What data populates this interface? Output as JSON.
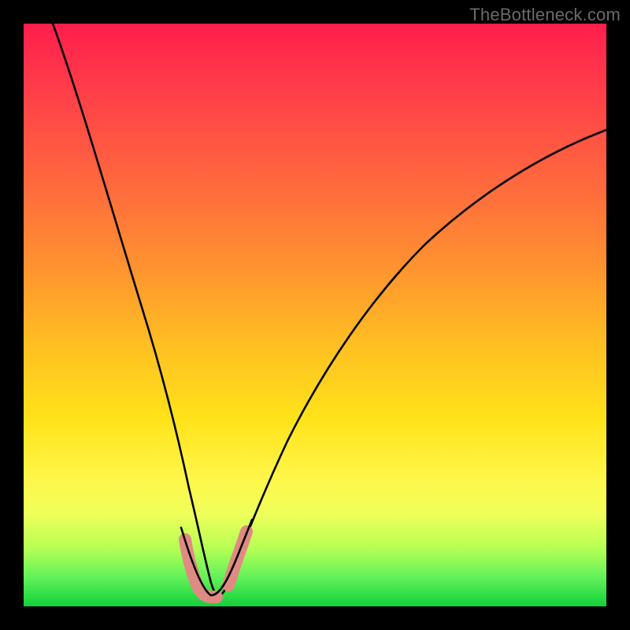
{
  "watermark": "TheBottleneck.com",
  "chart_data": {
    "type": "line",
    "title": "",
    "xlabel": "",
    "ylabel": "",
    "xlim": [
      0,
      100
    ],
    "ylim": [
      0,
      100
    ],
    "grid": false,
    "legend": false,
    "series": [
      {
        "name": "curve",
        "color": "#000000",
        "x": [
          5,
          8,
          12,
          16,
          20,
          23,
          25,
          27,
          29,
          30.5,
          32,
          34,
          35.5,
          40,
          46,
          54,
          62,
          72,
          84,
          100
        ],
        "y": [
          100,
          84,
          67,
          52,
          38,
          27,
          20,
          13,
          7,
          4,
          3,
          4,
          7,
          18,
          32,
          46,
          56,
          65,
          73,
          80
        ]
      },
      {
        "name": "highlight-left",
        "color": "#e08a84",
        "x": [
          27.5,
          28,
          29,
          30,
          30
        ],
        "y": [
          8,
          4,
          2.5,
          2.5,
          2.5
        ]
      },
      {
        "name": "highlight-right",
        "color": "#e08a84",
        "x": [
          33,
          34,
          35,
          35.7,
          36
        ],
        "y": [
          2.5,
          4,
          7,
          10,
          12
        ]
      }
    ],
    "annotations": []
  }
}
